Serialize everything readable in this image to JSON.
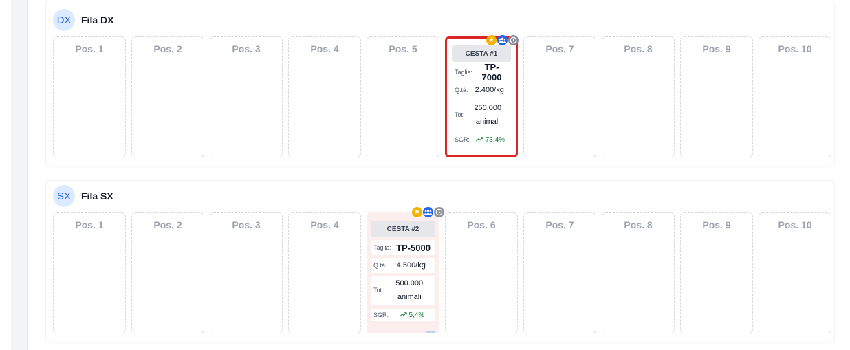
{
  "rows": [
    {
      "badge": "DX",
      "title": "Fila DX",
      "positions": [
        "Pos. 1",
        "Pos. 2",
        "Pos. 3",
        "Pos. 4",
        "Pos. 5",
        "",
        "Pos. 7",
        "Pos. 8",
        "Pos. 9",
        "Pos. 10"
      ],
      "basket": {
        "name": "CESTA #1",
        "size_label": "Taglia:",
        "size": "TP-7000",
        "qty_label": "Q.tà:",
        "qty": "2.400/kg",
        "tot_label": "Tot:",
        "tot_line1": "250.000",
        "tot_line2": "animali",
        "sgr_label": "SGR:",
        "sgr": "73,4%",
        "trend_icon": "trending-up-icon",
        "selected": true
      }
    },
    {
      "badge": "SX",
      "title": "Fila SX",
      "positions": [
        "Pos. 1",
        "Pos. 2",
        "Pos. 3",
        "Pos. 4",
        "",
        "Pos. 6",
        "Pos. 7",
        "Pos. 8",
        "Pos. 9",
        "Pos. 10"
      ],
      "basket": {
        "name": "CESTA #2",
        "size_label": "Taglia:",
        "size": "TP-5000",
        "qty_label": "Q.tà:",
        "qty": "4.500/kg",
        "tot_label": "Tot:",
        "tot_line1": "500.000",
        "tot_line2": "animali",
        "sgr_label": "SGR:",
        "sgr": "5,4%",
        "trend_icon": "trending-up-icon",
        "selected": false
      }
    }
  ],
  "icons": [
    "star-icon",
    "group-icon",
    "clock-icon"
  ],
  "colors": {
    "accent": "#2563eb",
    "selected_border": "#dc2626",
    "star": "#f5b301",
    "sgr": "#15803d",
    "highlight_bg": "#fdeeee"
  }
}
